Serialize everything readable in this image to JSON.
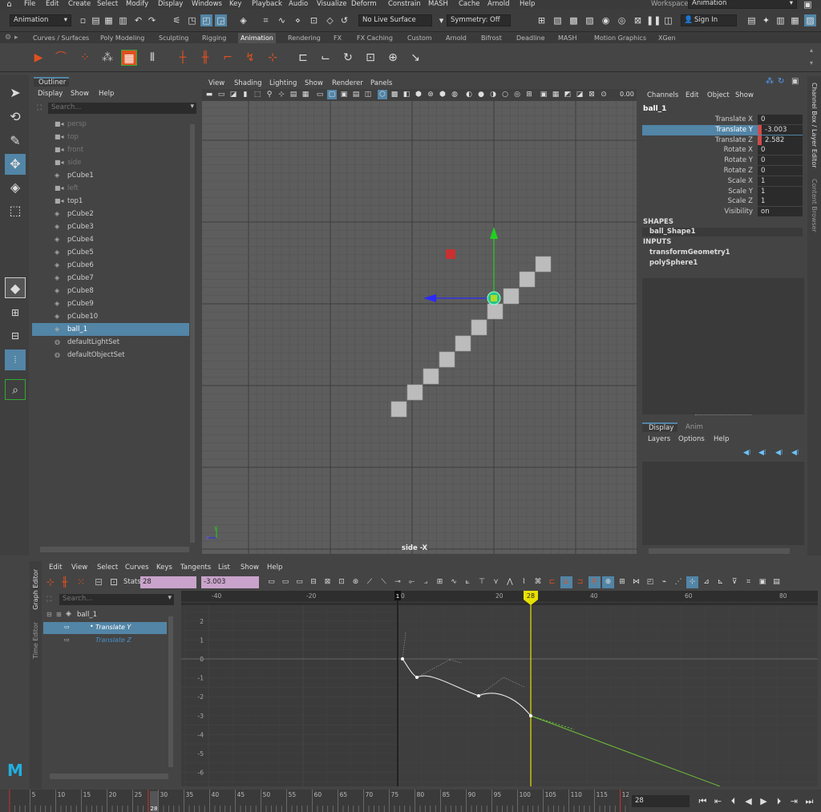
{
  "menubar": {
    "items": [
      "File",
      "Edit",
      "Create",
      "Select",
      "Modify",
      "Display",
      "Windows",
      "Key",
      "Playback",
      "Audio",
      "Visualize",
      "Deform",
      "Constrain",
      "MASH",
      "Cache",
      "Arnold",
      "Help"
    ],
    "workspace_label": "Workspace:",
    "workspace_value": "Animation"
  },
  "statusline": {
    "menuset": "Animation",
    "live_surface": "No Live Surface",
    "symmetry": "Symmetry: Off",
    "sign_in": "Sign In"
  },
  "shelf": {
    "tabs": [
      "Curves / Surfaces",
      "Poly Modeling",
      "Sculpting",
      "Rigging",
      "Animation",
      "Rendering",
      "FX",
      "FX Caching",
      "Custom",
      "Arnold",
      "Bifrost",
      "Deadline",
      "MASH",
      "Motion Graphics",
      "XGen"
    ],
    "active_tab": "Animation"
  },
  "outliner": {
    "title": "Outliner",
    "menu": [
      "Display",
      "Show",
      "Help"
    ],
    "search_placeholder": "Search...",
    "items": [
      {
        "label": "persp",
        "icon": "camera-icon",
        "dim": true
      },
      {
        "label": "top",
        "icon": "camera-icon",
        "dim": true
      },
      {
        "label": "front",
        "icon": "camera-icon",
        "dim": true
      },
      {
        "label": "side",
        "icon": "camera-icon",
        "dim": true
      },
      {
        "label": "pCube1",
        "icon": "mesh-icon",
        "dim": false
      },
      {
        "label": "left",
        "icon": "camera-icon",
        "dim": true
      },
      {
        "label": "top1",
        "icon": "camera-icon",
        "dim": false
      },
      {
        "label": "pCube2",
        "icon": "mesh-icon",
        "dim": false
      },
      {
        "label": "pCube3",
        "icon": "mesh-icon",
        "dim": false
      },
      {
        "label": "pCube4",
        "icon": "mesh-icon",
        "dim": false
      },
      {
        "label": "pCube5",
        "icon": "mesh-icon",
        "dim": false
      },
      {
        "label": "pCube6",
        "icon": "mesh-icon",
        "dim": false
      },
      {
        "label": "pCube7",
        "icon": "mesh-icon",
        "dim": false
      },
      {
        "label": "pCube8",
        "icon": "mesh-icon",
        "dim": false
      },
      {
        "label": "pCube9",
        "icon": "mesh-icon",
        "dim": false
      },
      {
        "label": "pCube10",
        "icon": "mesh-icon",
        "dim": false
      },
      {
        "label": "ball_1",
        "icon": "mesh-icon",
        "dim": false,
        "selected": true
      },
      {
        "label": "defaultLightSet",
        "icon": "set-icon",
        "dim": false
      },
      {
        "label": "defaultObjectSet",
        "icon": "set-icon",
        "dim": false
      }
    ]
  },
  "viewport": {
    "menu": [
      "View",
      "Shading",
      "Lighting",
      "Show",
      "Renderer",
      "Panels"
    ],
    "camera_label": "side -X",
    "exposure_value": "0.00",
    "axis_y": "y",
    "axis_z": "z"
  },
  "channelbox": {
    "menu": [
      "Channels",
      "Edit",
      "Object",
      "Show"
    ],
    "object_name": "ball_1",
    "channels": [
      {
        "label": "Translate X",
        "value": "0",
        "keyed": false,
        "highlight": false
      },
      {
        "label": "Translate Y",
        "value": "-3.003",
        "keyed": true,
        "highlight": true
      },
      {
        "label": "Translate Z",
        "value": "2.582",
        "keyed": true,
        "highlight": false
      },
      {
        "label": "Rotate X",
        "value": "0",
        "keyed": false,
        "highlight": false
      },
      {
        "label": "Rotate Y",
        "value": "0",
        "keyed": false,
        "highlight": false
      },
      {
        "label": "Rotate Z",
        "value": "0",
        "keyed": false,
        "highlight": false
      },
      {
        "label": "Scale X",
        "value": "1",
        "keyed": false,
        "highlight": false
      },
      {
        "label": "Scale Y",
        "value": "1",
        "keyed": false,
        "highlight": false
      },
      {
        "label": "Scale Z",
        "value": "1",
        "keyed": false,
        "highlight": false
      },
      {
        "label": "Visibility",
        "value": "on",
        "keyed": false,
        "highlight": false
      }
    ],
    "shapes_header": "SHAPES",
    "shape_name": "ball_Shape1",
    "inputs_header": "INPUTS",
    "inputs": [
      "transformGeometry1",
      "polySphere1"
    ],
    "side_tabs": [
      "Channel Box / Layer Editor",
      "Content Browser"
    ]
  },
  "layer_editor": {
    "tabs": [
      "Display",
      "Anim"
    ],
    "active_tab": "Display",
    "menu": [
      "Layers",
      "Options",
      "Help"
    ]
  },
  "graph_editor": {
    "menu": [
      "Edit",
      "View",
      "Select",
      "Curves",
      "Keys",
      "Tangents",
      "List",
      "Show",
      "Help"
    ],
    "stats_label": "Stats",
    "stats_frame": "28",
    "stats_value": "-3.003",
    "search_placeholder": "Search...",
    "tree_root": "ball_1",
    "curves": [
      "Translate Y",
      "Translate Z"
    ],
    "side_tabs": [
      "Graph Editor",
      "Time Editor"
    ],
    "x_ticks": [
      -40,
      -20,
      0,
      20,
      40,
      60,
      80
    ],
    "y_ticks": [
      2,
      1,
      0,
      -1,
      -2,
      -3,
      -4,
      -5,
      -6
    ],
    "current_frame_marker": "28",
    "start_marker": "1"
  },
  "timeslider": {
    "ticks": [
      5,
      10,
      15,
      20,
      25,
      30,
      35,
      40,
      45,
      50,
      55,
      60,
      65,
      70,
      75,
      80,
      85,
      90,
      95,
      100,
      105,
      110,
      115,
      12
    ],
    "current_frame_label": "28",
    "current_frame_field": "28"
  },
  "colors": {
    "selection": "#5285a6",
    "keyed": "#cd4c4c",
    "manip_y": "#1fd11f",
    "manip_z": "#1a1aff",
    "current_time": "#e8e000",
    "graph_curve": "#dddddd",
    "graph_z_curve": "#6fbf3a"
  }
}
